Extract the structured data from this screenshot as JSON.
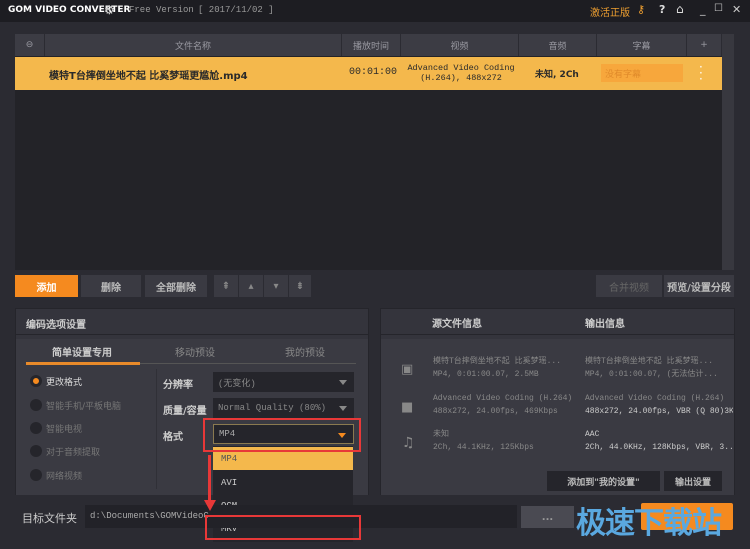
{
  "title": {
    "app": "GOM VIDEO CONVERTER",
    "version": "Free Version",
    "date": "[ 2017/11/02 ]",
    "activate": "激活正版"
  },
  "accent": "#f58a1f",
  "table": {
    "headers": [
      "文件名称",
      "播放时间",
      "视频",
      "音频",
      "字幕",
      "+"
    ],
    "row": {
      "name": "模特T台摔倒坐地不起 比奚梦瑶更尴尬.mp4",
      "duration": "00:01:00",
      "video": "Advanced Video Coding (H.264), 488x272",
      "audio": "未知, 2Ch",
      "subtitle_placeholder": "没有字幕"
    }
  },
  "toolbar": {
    "add": "添加",
    "delete": "删除",
    "delete_all": "全部删除",
    "merge": "合并视频",
    "preview": "预览/设置分段"
  },
  "encode": {
    "title": "编码选项设置",
    "tabs": [
      "简单设置专用",
      "移动预设",
      "我的预设"
    ],
    "radios": [
      "更改格式",
      "智能手机/平板电脑",
      "智能电视",
      "对于音频提取",
      "网络视频"
    ],
    "resolution_label": "分辨率",
    "resolution_value": "(无变化)",
    "quality_label": "质量/容量",
    "quality_value": "Normal Quality (80%)",
    "format_label": "格式",
    "format_value": "MP4",
    "format_options": [
      "MP4",
      "AVI",
      "OGM",
      "MKV"
    ]
  },
  "info": {
    "source_title": "源文件信息",
    "output_title": "输出信息",
    "source": [
      [
        "模特T台摔倒坐地不起 比奚梦瑶...",
        "MP4, 0:01:00.07, 2.5MB"
      ],
      [
        "Advanced Video Coding (H.264)",
        "488x272, 24.00fps, 469Kbps"
      ],
      [
        "未知",
        "2Ch, 44.1KHz, 125Kbps"
      ]
    ],
    "output": [
      [
        "模特T台摔倒坐地不起 比奚梦瑶...",
        "MP4, 0:01:00.07, (无法估计..."
      ],
      [
        "Advanced Video Coding (H.264)",
        "488x272, 24.00fps, VBR (Q 80)3K"
      ],
      [
        "AAC",
        "2Ch, 44.0KHz, 128Kbps, VBR, 3..."
      ]
    ],
    "add_preset": "添加到\"我的设置\"",
    "output_settings": "输出设置"
  },
  "target": {
    "label": "目标文件夹",
    "path": "d:\\Documents\\GOMVideoC",
    "browse": "..."
  },
  "watermark": "极速下载站"
}
